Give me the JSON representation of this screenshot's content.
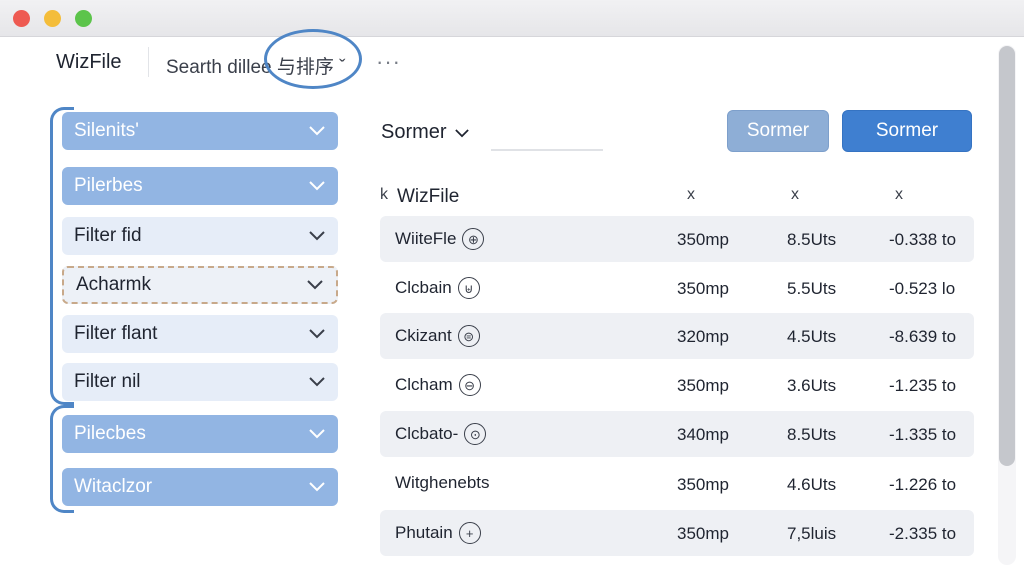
{
  "window": {
    "controls": [
      "close",
      "minimize",
      "zoom"
    ]
  },
  "header": {
    "app_title": "WizFile",
    "search_label": "Searth dillee 与排序 ˇ",
    "more_icon": "more-horizontal-icon"
  },
  "sidebar": {
    "filters": [
      {
        "label": "Silenits'",
        "style": "blue"
      },
      {
        "label": "Pilerbes",
        "style": "blue"
      },
      {
        "label": "Filter fid",
        "style": "light"
      },
      {
        "label": "Acharmk",
        "style": "dashed"
      },
      {
        "label": "Filter flant",
        "style": "light"
      },
      {
        "label": "Filter nil",
        "style": "light"
      },
      {
        "label": "Pilecbes",
        "style": "blue"
      },
      {
        "label": "Witaclzor",
        "style": "blue"
      }
    ],
    "chevron_icon": "chevron-down-icon"
  },
  "toolbar": {
    "sort_label": "Sormer",
    "sort_input_value": "",
    "secondary_button": "Sormer",
    "primary_button": "Sormer"
  },
  "table": {
    "headers": [
      "WizFile",
      "x",
      "x",
      "x"
    ],
    "header_prefix": "k",
    "rows": [
      {
        "name": "WiiteFle",
        "icon": "⊕",
        "size": "350mp",
        "col2": "8.5Uts",
        "col3": "-0.338 to"
      },
      {
        "name": "Clcbain",
        "icon": "⊎",
        "size": "350mp",
        "col2": "5.5Uts",
        "col3": "-0.523 lo"
      },
      {
        "name": "Ckizant",
        "icon": "⊜",
        "size": "320mp",
        "col2": "4.5Uts",
        "col3": "-8.639 to"
      },
      {
        "name": "Clcham",
        "icon": "⊖",
        "size": "350mp",
        "col2": "3.6Uts",
        "col3": "-1.235 to"
      },
      {
        "name": "Clcbato-",
        "icon": "⊙",
        "size": "340mp",
        "col2": "8.5Uts",
        "col3": "-1.335 to"
      },
      {
        "name": "Witghenebts",
        "icon": "",
        "size": "350mp",
        "col2": "4.6Uts",
        "col3": "-1.226 to"
      },
      {
        "name": "Phutain",
        "icon": "+",
        "size": "350mp",
        "col2": "7,5luis",
        "col3": "-2.335 to"
      }
    ]
  },
  "colors": {
    "accent": "#3f7fd0",
    "filter_blue": "#92b5e3",
    "annotation_blue": "#4f86c6"
  }
}
